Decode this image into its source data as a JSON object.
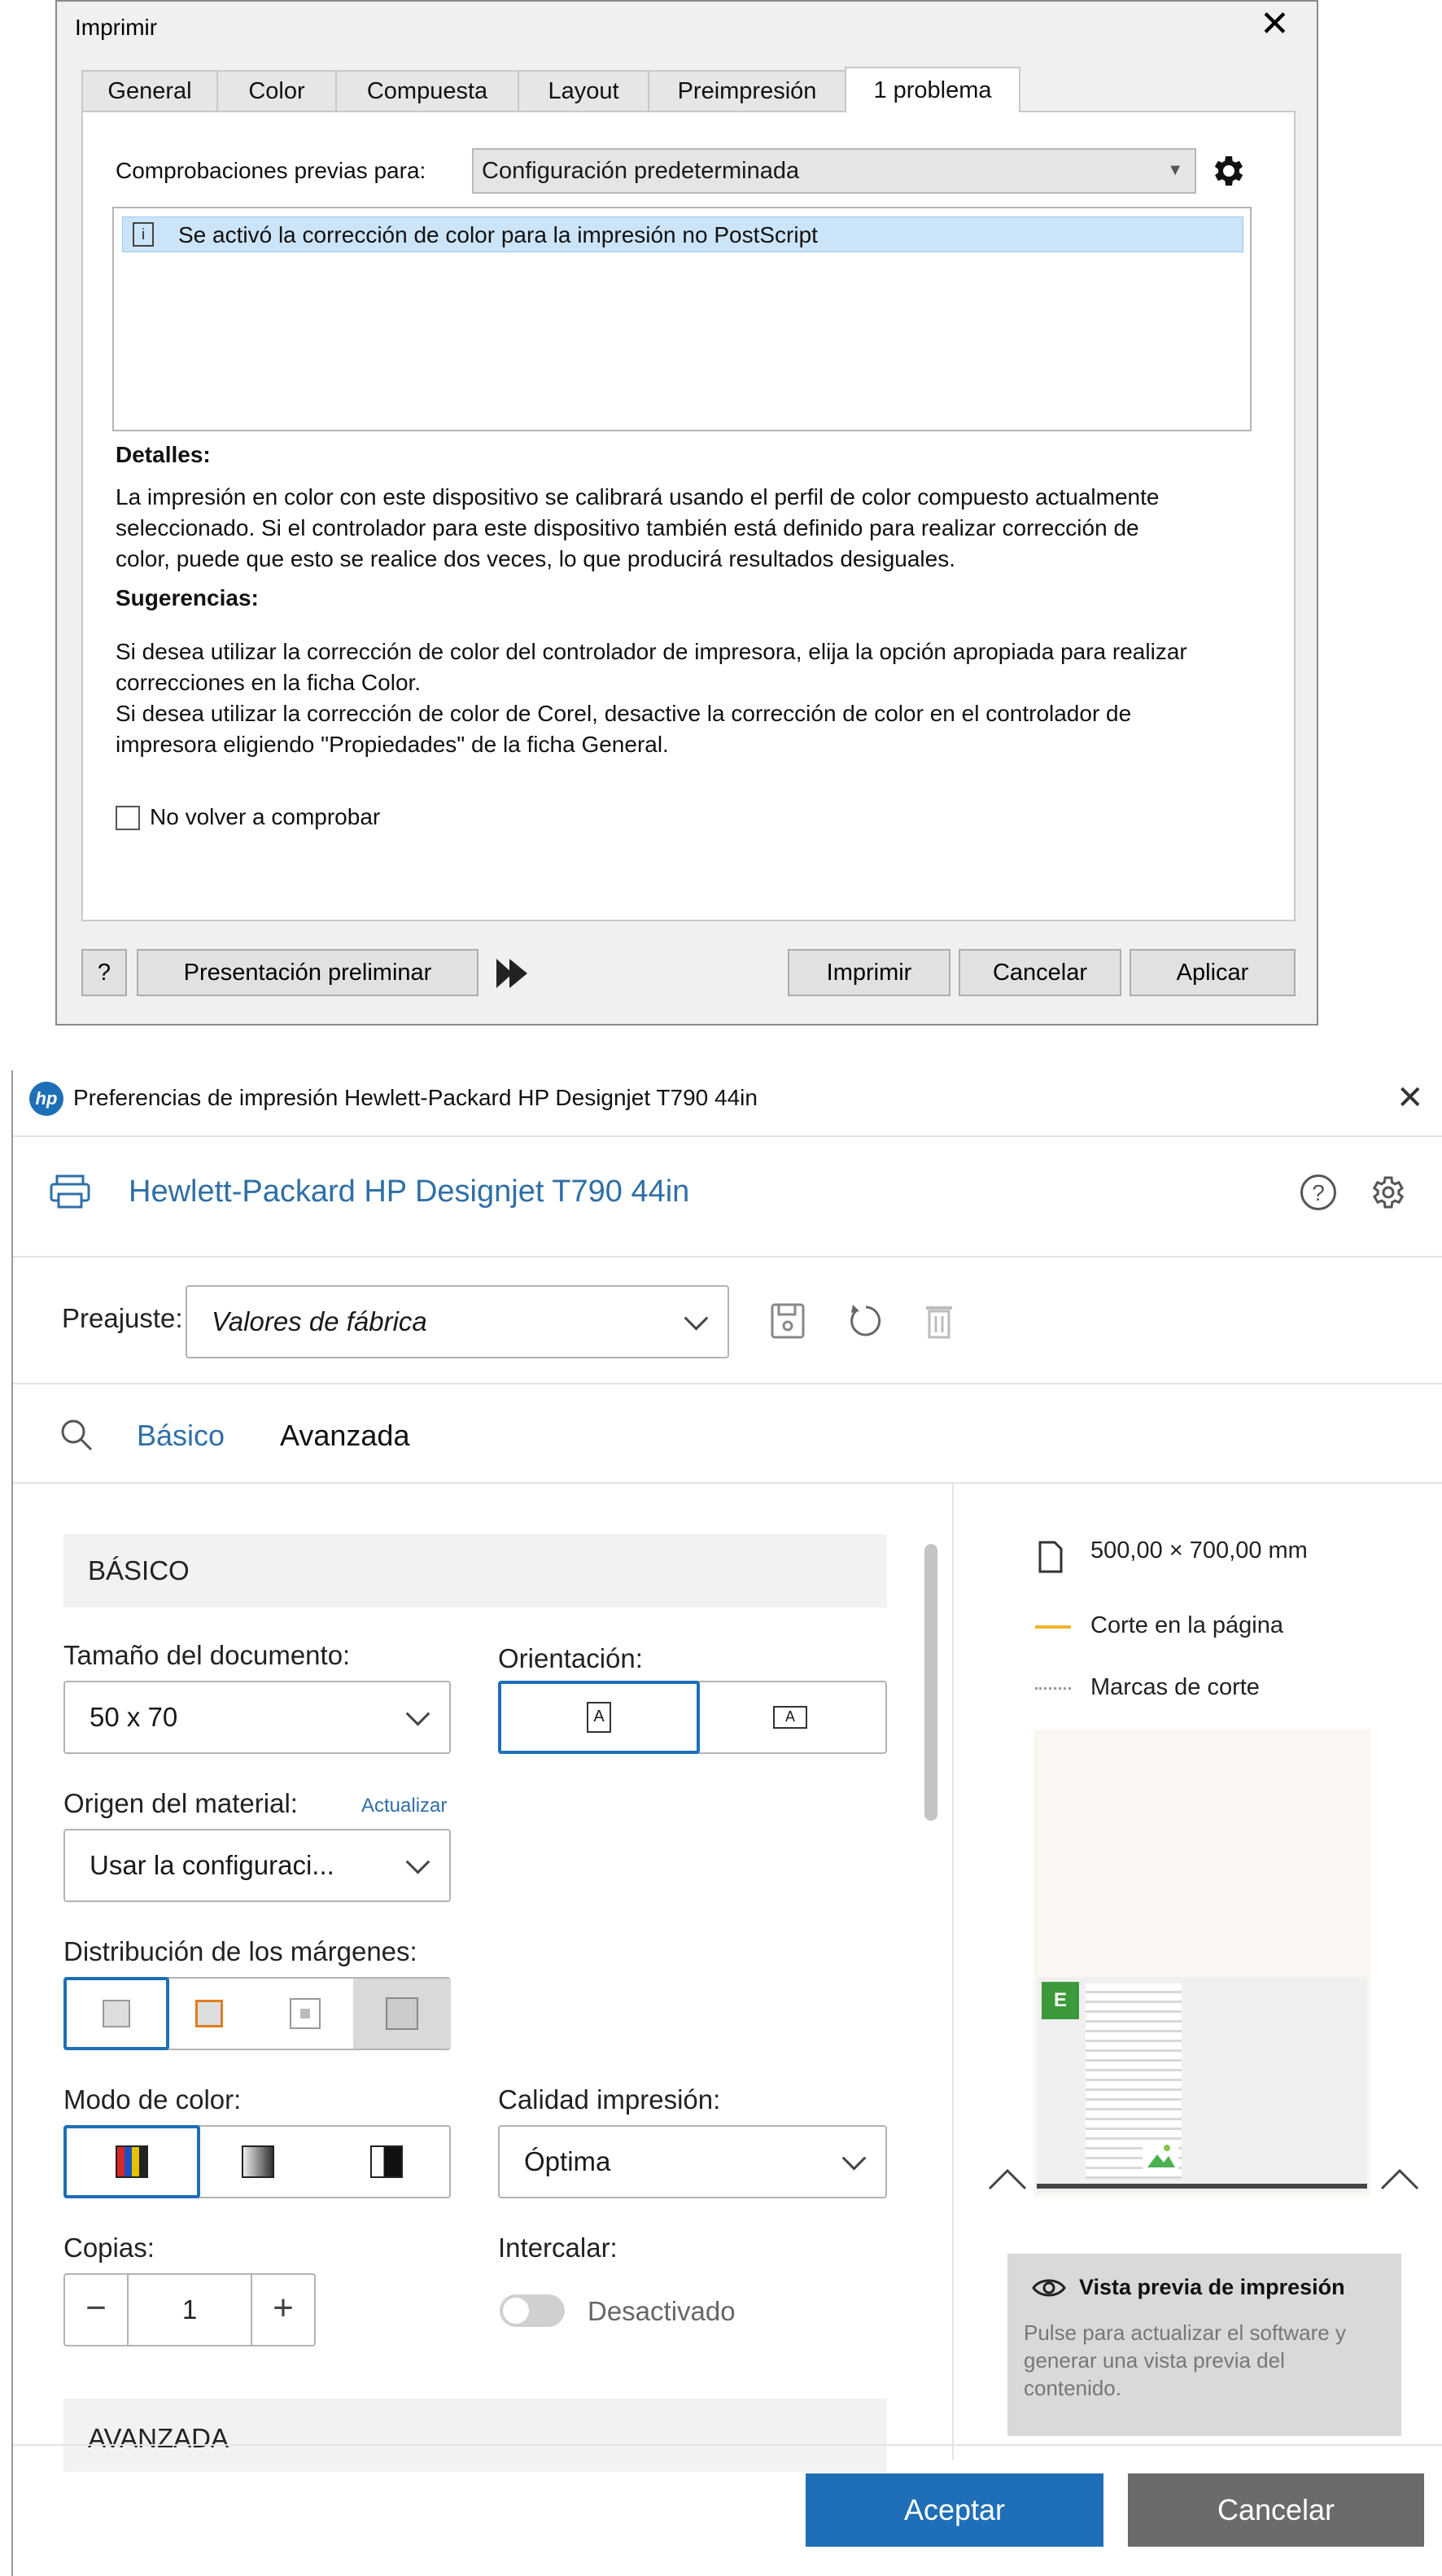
{
  "print_dialog": {
    "title": "Imprimir",
    "tabs": [
      "General",
      "Color",
      "Compuesta",
      "Layout",
      "Preimpresión",
      "1 problema"
    ],
    "active_tab": "1 problema",
    "preflight_label": "Comprobaciones previas para:",
    "preflight_value": "Configuración predeterminada",
    "issues": [
      "Se activó la corrección de color para la impresión no PostScript"
    ],
    "details_heading": "Detalles:",
    "details_lines": [
      "La impresión en color con este dispositivo se calibrará usando el perfil de color compuesto actualmente",
      "seleccionado. Si el controlador para este dispositivo también está definido para realizar corrección de",
      "color, puede que esto se realice dos veces, lo que producirá resultados desiguales."
    ],
    "suggestions_heading": "Sugerencias:",
    "suggestions_lines": [
      "Si desea utilizar la corrección de color del controlador de impresora, elija la opción apropiada para realizar",
      "correcciones en la ficha Color.",
      "Si desea utilizar la corrección de color de Corel, desactive la corrección de color en el controlador de",
      "impresora eligiendo \"Propiedades\" de la ficha General."
    ],
    "dont_check_again": "No volver a comprobar",
    "help_button": "?",
    "preview_button": "Presentación preliminar",
    "print_button": "Imprimir",
    "cancel_button": "Cancelar",
    "apply_button": "Aplicar"
  },
  "hp_dialog": {
    "title": "Preferencias de impresión Hewlett-Packard HP Designjet T790 44in",
    "printer_name": "Hewlett-Packard HP Designjet T790 44in",
    "preset_label": "Preajuste:",
    "preset_value": "Valores de fábrica",
    "tabs": {
      "basic": "Básico",
      "advanced": "Avanzada"
    },
    "section_basic": "BÁSICO",
    "doc_size_label": "Tamaño del documento:",
    "doc_size_value": "50 x 70",
    "orientation_label": "Orientación:",
    "media_source_label": "Origen del material:",
    "media_update_link": "Actualizar",
    "media_source_value": "Usar la configuraci...",
    "margins_label": "Distribución de los márgenes:",
    "color_mode_label": "Modo de color:",
    "quality_label": "Calidad impresión:",
    "quality_value": "Óptima",
    "copies_label": "Copias:",
    "copies_value": "1",
    "collate_label": "Intercalar:",
    "collate_state": "Desactivado",
    "section_advanced": "AVANZADA",
    "paper_size": "500,00 × 700,00 mm",
    "legend_cut": "Corte en la página",
    "legend_marks": "Marcas de corte",
    "preview_badge": "E",
    "preview_box_title": "Vista previa de impresión",
    "preview_box_text": [
      "Pulse para actualizar el software y",
      "generar una vista previa del",
      "contenido."
    ],
    "accept_button": "Aceptar",
    "cancel_button": "Cancelar",
    "colors": {
      "accent": "#1e6fb8",
      "link": "#2f6fa7",
      "cut_line": "#f0b429",
      "cancel_bg": "#6b6b6b"
    }
  }
}
